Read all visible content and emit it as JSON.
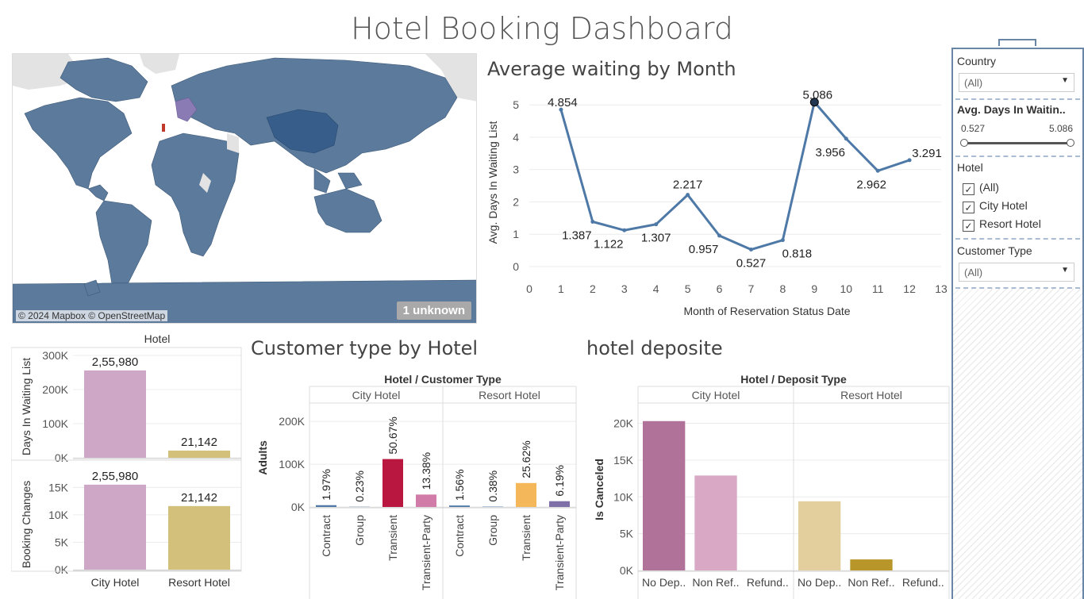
{
  "dashboard": {
    "title": "Hotel Booking Dashboard"
  },
  "map": {
    "attribution": "© 2024 Mapbox © OpenStreetMap",
    "unknown_badge": "1 unknown",
    "colors": {
      "ocean": "#ffffff",
      "land_missing": "#e3e3e3",
      "country": "#5b7a9c",
      "china": "#375d8a",
      "europe_highlight": "#8a7bb5",
      "portugal": "#c0392b"
    }
  },
  "filters": {
    "country": {
      "label": "Country",
      "value": "(All)"
    },
    "avg_days": {
      "label": "Avg. Days In Waitin..",
      "min": "0.527",
      "max": "5.086"
    },
    "hotel": {
      "label": "Hotel",
      "options": [
        {
          "label": "(All)",
          "checked": true
        },
        {
          "label": "City Hotel",
          "checked": true
        },
        {
          "label": "Resort Hotel",
          "checked": true
        }
      ]
    },
    "customer_type": {
      "label": "Customer Type",
      "value": "(All)"
    }
  },
  "titles": {
    "line": "Average waiting by Month",
    "customer": "Customer type by Hotel",
    "deposit": "hotel deposite"
  },
  "chart_data": [
    {
      "id": "avg_waiting",
      "type": "line",
      "xlabel": "Month of Reservation Status Date",
      "ylabel": "Avg. Days In Waiting List",
      "xlim": [
        0,
        13
      ],
      "ylim": [
        0,
        5.3
      ],
      "xticks": [
        "0",
        "1",
        "2",
        "3",
        "4",
        "5",
        "6",
        "7",
        "8",
        "9",
        "10",
        "11",
        "12",
        "13"
      ],
      "yticks": [
        "0",
        "1",
        "2",
        "3",
        "4",
        "5"
      ],
      "x": [
        1,
        2,
        3,
        4,
        5,
        6,
        7,
        8,
        9,
        10,
        11,
        12
      ],
      "y": [
        4.854,
        1.387,
        1.122,
        1.307,
        2.217,
        0.957,
        0.527,
        0.818,
        5.086,
        3.956,
        2.962,
        3.291
      ],
      "labels": [
        "4.854",
        "1.387",
        "1.122",
        "1.307",
        "2.217",
        "0.957",
        "0.527",
        "0.818",
        "5.086",
        "3.956",
        "2.962",
        "3.291"
      ],
      "color": "#4e79a7",
      "grid": true
    },
    {
      "id": "hotel_bars",
      "type": "bar",
      "header": "Hotel",
      "categories": [
        "City Hotel",
        "Resort Hotel"
      ],
      "colors": [
        "#cfa7c6",
        "#d3c07b"
      ],
      "panels": [
        {
          "ylabel": "Days In Waiting List",
          "values": [
            255980,
            21142
          ],
          "labels": [
            "2,55,980",
            "21,142"
          ],
          "yticks": [
            "0K",
            "100K",
            "200K",
            "300K"
          ],
          "ylim": [
            0,
            300000
          ]
        },
        {
          "ylabel": "Booking Changes",
          "values": [
            15500,
            11600
          ],
          "labels": [
            "2,55,980",
            "21,142"
          ],
          "yticks": [
            "0K",
            "5K",
            "10K",
            "15K"
          ],
          "ylim": [
            0,
            16500
          ]
        }
      ]
    },
    {
      "id": "customer_type",
      "type": "bar",
      "header": "Hotel  /  Customer Type",
      "ylabel": "Adults",
      "yticks": [
        "0K",
        "100K",
        "200K"
      ],
      "ylim": [
        0,
        230000
      ],
      "groups": [
        {
          "name": "City Hotel",
          "categories": [
            "Contract",
            "Group",
            "Transient",
            "Transient-Party"
          ],
          "values": [
            4200,
            500,
            112000,
            29000
          ],
          "labels": [
            "1.97%",
            "0.23%",
            "50.67%",
            "13.38%"
          ],
          "colors": [
            "#4e79a7",
            "#4e79a7",
            "#b9173f",
            "#d07ba8"
          ]
        },
        {
          "name": "Resort Hotel",
          "categories": [
            "Contract",
            "Group",
            "Transient",
            "Transient-Party"
          ],
          "values": [
            3400,
            800,
            56000,
            13500
          ],
          "labels": [
            "1.56%",
            "0.38%",
            "25.62%",
            "6.19%"
          ],
          "colors": [
            "#4e79a7",
            "#4e79a7",
            "#f4b75a",
            "#7f6fa8"
          ]
        }
      ]
    },
    {
      "id": "deposit",
      "type": "bar",
      "header": "Hotel  /  Deposit Type",
      "ylabel": "Is Canceled",
      "yticks": [
        "0K",
        "5K",
        "10K",
        "15K",
        "20K"
      ],
      "ylim": [
        0,
        22000
      ],
      "groups": [
        {
          "name": "City Hotel",
          "categories": [
            "No Dep..",
            "Non Ref..",
            "Refund.."
          ],
          "values": [
            20300,
            12900,
            0
          ],
          "colors": [
            "#b07298",
            "#d8a8c5",
            "#d8a8c5"
          ]
        },
        {
          "name": "Resort Hotel",
          "categories": [
            "No Dep..",
            "Non Ref..",
            "Refund.."
          ],
          "values": [
            9400,
            1500,
            0
          ],
          "colors": [
            "#e3cf9d",
            "#b8962a",
            "#b8962a"
          ]
        }
      ]
    }
  ]
}
